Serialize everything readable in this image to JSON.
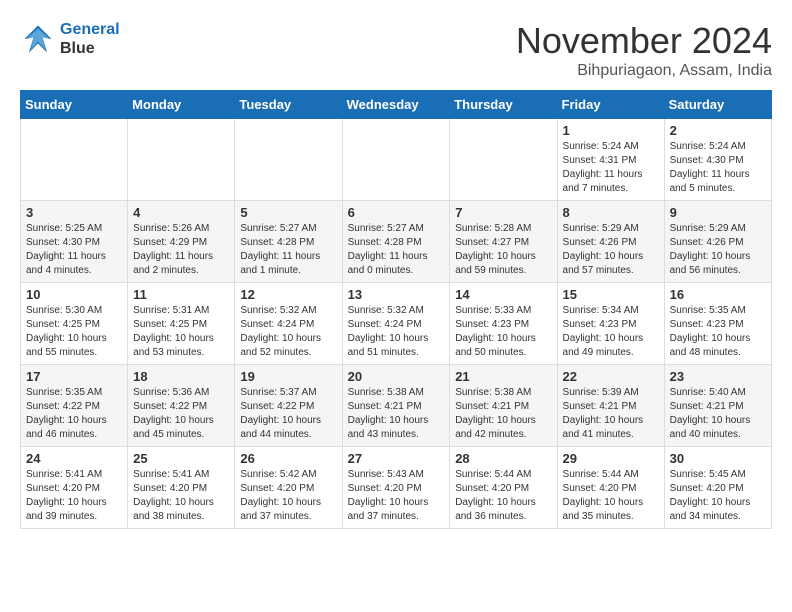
{
  "logo": {
    "line1": "General",
    "line2": "Blue"
  },
  "title": "November 2024",
  "subtitle": "Bihpuriagaon, Assam, India",
  "weekdays": [
    "Sunday",
    "Monday",
    "Tuesday",
    "Wednesday",
    "Thursday",
    "Friday",
    "Saturday"
  ],
  "weeks": [
    [
      {
        "day": "",
        "info": ""
      },
      {
        "day": "",
        "info": ""
      },
      {
        "day": "",
        "info": ""
      },
      {
        "day": "",
        "info": ""
      },
      {
        "day": "",
        "info": ""
      },
      {
        "day": "1",
        "info": "Sunrise: 5:24 AM\nSunset: 4:31 PM\nDaylight: 11 hours\nand 7 minutes."
      },
      {
        "day": "2",
        "info": "Sunrise: 5:24 AM\nSunset: 4:30 PM\nDaylight: 11 hours\nand 5 minutes."
      }
    ],
    [
      {
        "day": "3",
        "info": "Sunrise: 5:25 AM\nSunset: 4:30 PM\nDaylight: 11 hours\nand 4 minutes."
      },
      {
        "day": "4",
        "info": "Sunrise: 5:26 AM\nSunset: 4:29 PM\nDaylight: 11 hours\nand 2 minutes."
      },
      {
        "day": "5",
        "info": "Sunrise: 5:27 AM\nSunset: 4:28 PM\nDaylight: 11 hours\nand 1 minute."
      },
      {
        "day": "6",
        "info": "Sunrise: 5:27 AM\nSunset: 4:28 PM\nDaylight: 11 hours\nand 0 minutes."
      },
      {
        "day": "7",
        "info": "Sunrise: 5:28 AM\nSunset: 4:27 PM\nDaylight: 10 hours\nand 59 minutes."
      },
      {
        "day": "8",
        "info": "Sunrise: 5:29 AM\nSunset: 4:26 PM\nDaylight: 10 hours\nand 57 minutes."
      },
      {
        "day": "9",
        "info": "Sunrise: 5:29 AM\nSunset: 4:26 PM\nDaylight: 10 hours\nand 56 minutes."
      }
    ],
    [
      {
        "day": "10",
        "info": "Sunrise: 5:30 AM\nSunset: 4:25 PM\nDaylight: 10 hours\nand 55 minutes."
      },
      {
        "day": "11",
        "info": "Sunrise: 5:31 AM\nSunset: 4:25 PM\nDaylight: 10 hours\nand 53 minutes."
      },
      {
        "day": "12",
        "info": "Sunrise: 5:32 AM\nSunset: 4:24 PM\nDaylight: 10 hours\nand 52 minutes."
      },
      {
        "day": "13",
        "info": "Sunrise: 5:32 AM\nSunset: 4:24 PM\nDaylight: 10 hours\nand 51 minutes."
      },
      {
        "day": "14",
        "info": "Sunrise: 5:33 AM\nSunset: 4:23 PM\nDaylight: 10 hours\nand 50 minutes."
      },
      {
        "day": "15",
        "info": "Sunrise: 5:34 AM\nSunset: 4:23 PM\nDaylight: 10 hours\nand 49 minutes."
      },
      {
        "day": "16",
        "info": "Sunrise: 5:35 AM\nSunset: 4:23 PM\nDaylight: 10 hours\nand 48 minutes."
      }
    ],
    [
      {
        "day": "17",
        "info": "Sunrise: 5:35 AM\nSunset: 4:22 PM\nDaylight: 10 hours\nand 46 minutes."
      },
      {
        "day": "18",
        "info": "Sunrise: 5:36 AM\nSunset: 4:22 PM\nDaylight: 10 hours\nand 45 minutes."
      },
      {
        "day": "19",
        "info": "Sunrise: 5:37 AM\nSunset: 4:22 PM\nDaylight: 10 hours\nand 44 minutes."
      },
      {
        "day": "20",
        "info": "Sunrise: 5:38 AM\nSunset: 4:21 PM\nDaylight: 10 hours\nand 43 minutes."
      },
      {
        "day": "21",
        "info": "Sunrise: 5:38 AM\nSunset: 4:21 PM\nDaylight: 10 hours\nand 42 minutes."
      },
      {
        "day": "22",
        "info": "Sunrise: 5:39 AM\nSunset: 4:21 PM\nDaylight: 10 hours\nand 41 minutes."
      },
      {
        "day": "23",
        "info": "Sunrise: 5:40 AM\nSunset: 4:21 PM\nDaylight: 10 hours\nand 40 minutes."
      }
    ],
    [
      {
        "day": "24",
        "info": "Sunrise: 5:41 AM\nSunset: 4:20 PM\nDaylight: 10 hours\nand 39 minutes."
      },
      {
        "day": "25",
        "info": "Sunrise: 5:41 AM\nSunset: 4:20 PM\nDaylight: 10 hours\nand 38 minutes."
      },
      {
        "day": "26",
        "info": "Sunrise: 5:42 AM\nSunset: 4:20 PM\nDaylight: 10 hours\nand 37 minutes."
      },
      {
        "day": "27",
        "info": "Sunrise: 5:43 AM\nSunset: 4:20 PM\nDaylight: 10 hours\nand 37 minutes."
      },
      {
        "day": "28",
        "info": "Sunrise: 5:44 AM\nSunset: 4:20 PM\nDaylight: 10 hours\nand 36 minutes."
      },
      {
        "day": "29",
        "info": "Sunrise: 5:44 AM\nSunset: 4:20 PM\nDaylight: 10 hours\nand 35 minutes."
      },
      {
        "day": "30",
        "info": "Sunrise: 5:45 AM\nSunset: 4:20 PM\nDaylight: 10 hours\nand 34 minutes."
      }
    ]
  ]
}
